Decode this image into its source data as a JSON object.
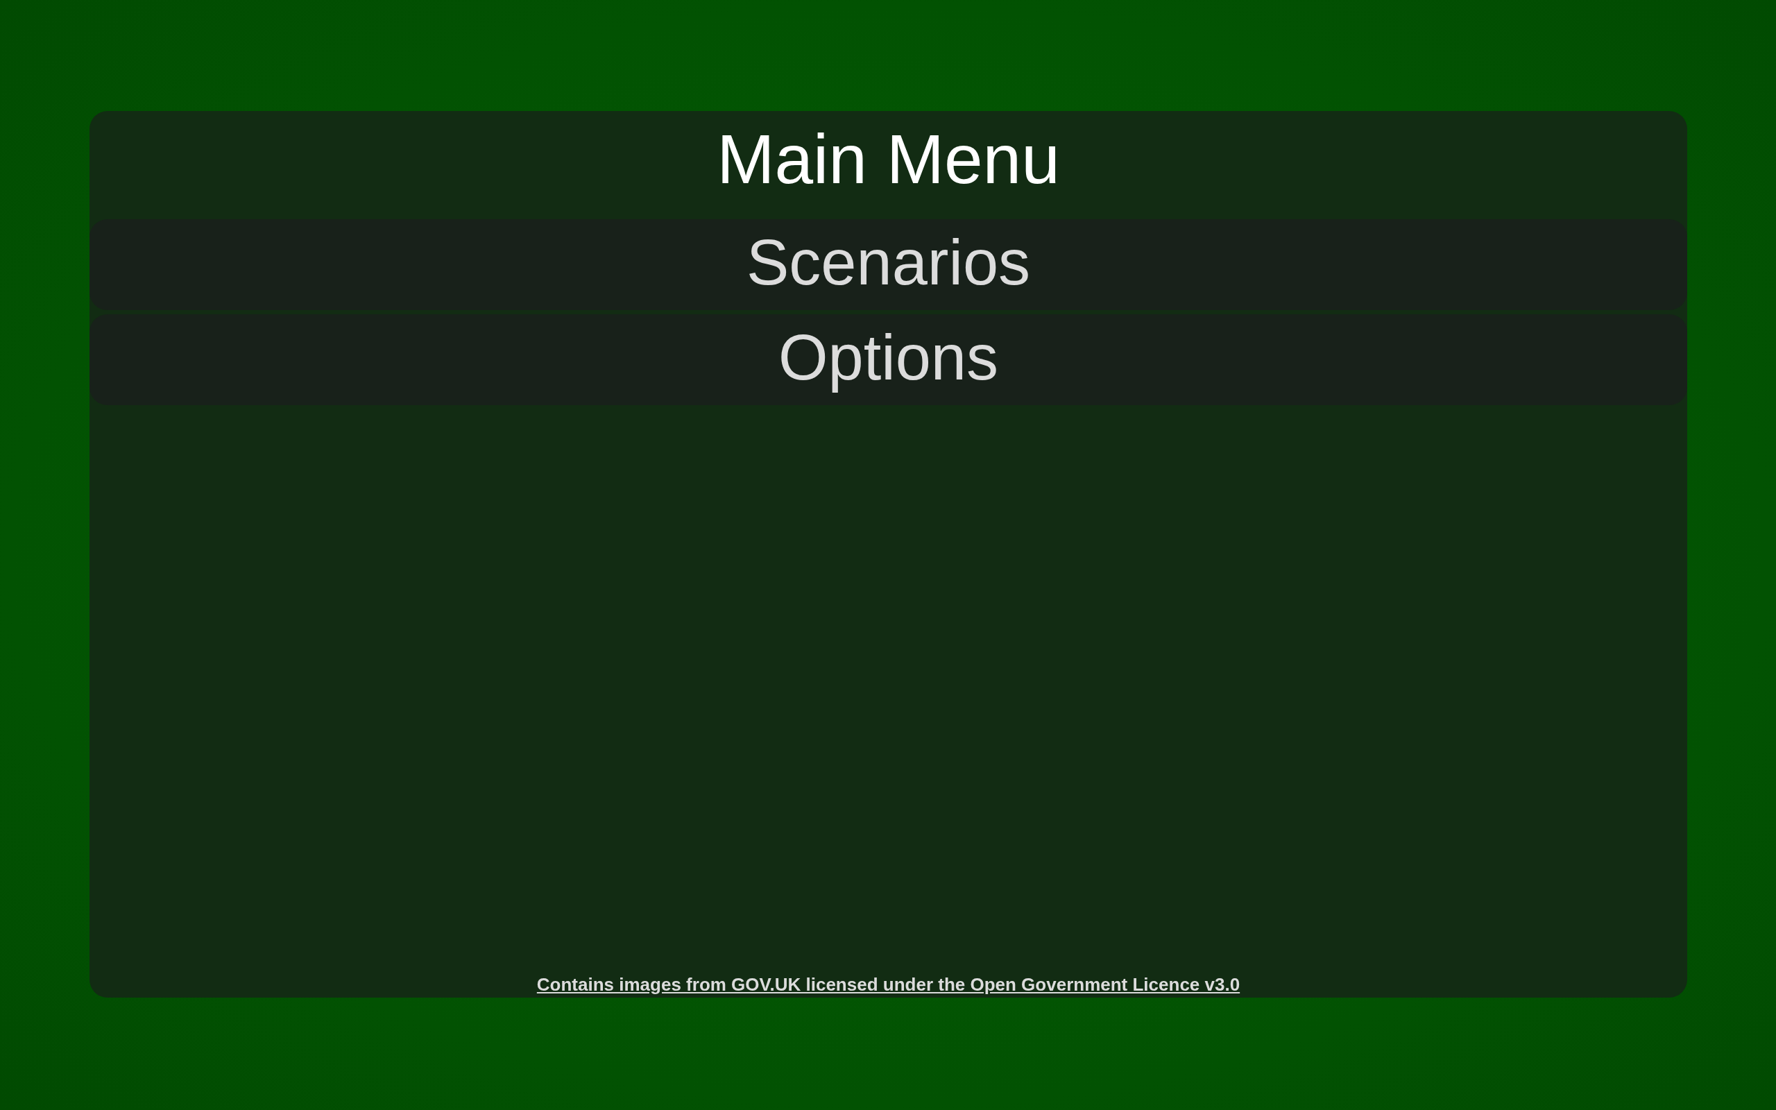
{
  "title": "Main Menu",
  "menu_items": [
    {
      "label": "Scenarios"
    },
    {
      "label": "Options"
    }
  ],
  "footer_link": "Contains images from GOV.UK licensed under the Open Government Licence v3.0"
}
